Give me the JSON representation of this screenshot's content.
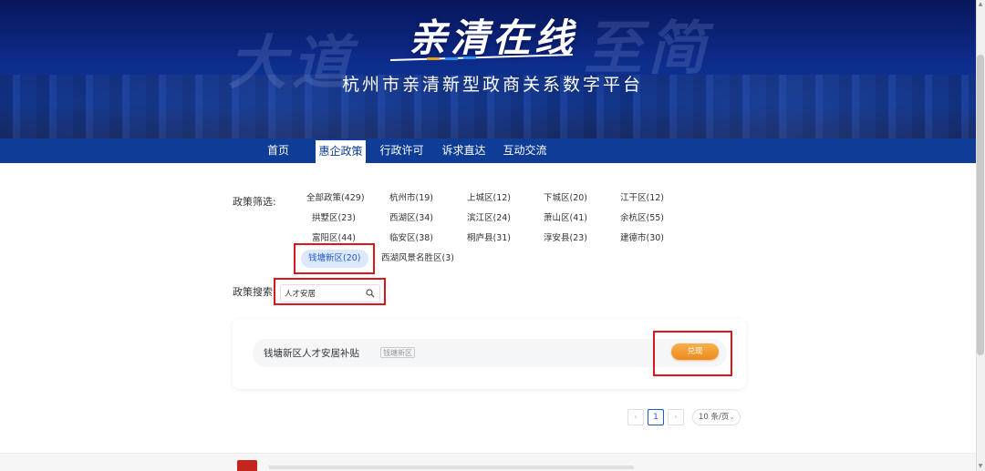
{
  "banner": {
    "ghost_left": "大道",
    "ghost_right": "至简",
    "logo": "亲清在线",
    "subtitle": "杭州市亲清新型政商关系数字平台"
  },
  "nav": {
    "items": [
      {
        "label": "首页",
        "active": false
      },
      {
        "label": "惠企政策",
        "active": true
      },
      {
        "label": "行政许可",
        "active": false
      },
      {
        "label": "诉求直达",
        "active": false
      },
      {
        "label": "互动交流",
        "active": false
      }
    ]
  },
  "filter": {
    "label": "政策筛选:",
    "items": [
      "全部政策(429)",
      "杭州市(19)",
      "上城区(12)",
      "下城区(20)",
      "江干区(12)",
      "拱墅区(23)",
      "西湖区(34)",
      "滨江区(24)",
      "萧山区(41)",
      "余杭区(55)",
      "富阳区(44)",
      "临安区(38)",
      "桐庐县(31)",
      "淳安县(23)",
      "建德市(30)",
      "钱塘新区(20)",
      "西湖风景名胜区(3)"
    ],
    "selected": "钱塘新区(20)"
  },
  "search": {
    "label": "政策搜索:",
    "value": "人才安居"
  },
  "results": [
    {
      "title": "钱塘新区人才安居补贴",
      "tag": "钱塘新区",
      "action": "兑现"
    }
  ],
  "pager": {
    "prev": "‹",
    "current": "1",
    "next": "›",
    "page_size": "10 条/页"
  },
  "colors": {
    "nav_bg": "#0e3c96",
    "accent": "#1e5bd1",
    "button": "#ef8a1d",
    "highlight_box": "#d9181d"
  }
}
